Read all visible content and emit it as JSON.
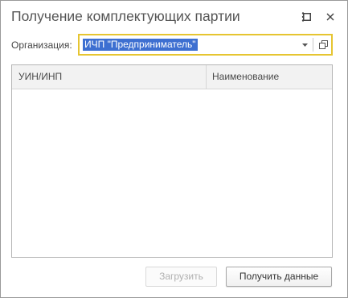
{
  "window": {
    "title": "Получение комплектующих партии",
    "more_icon": "more-vertical-icon",
    "maximize_icon": "maximize-icon",
    "close_icon": "close-icon"
  },
  "organization": {
    "label": "Организация:",
    "value": "ИЧП \"Предприниматель\"",
    "dropdown_icon": "chevron-down-icon",
    "open_icon": "open-icon",
    "focus_color": "#e6c531",
    "selection_color": "#3d6fd1"
  },
  "table": {
    "columns": [
      "УИН/ИНП",
      "Наименование"
    ],
    "rows": []
  },
  "buttons": {
    "load_label": "Загрузить",
    "get_data_label": "Получить данные"
  }
}
